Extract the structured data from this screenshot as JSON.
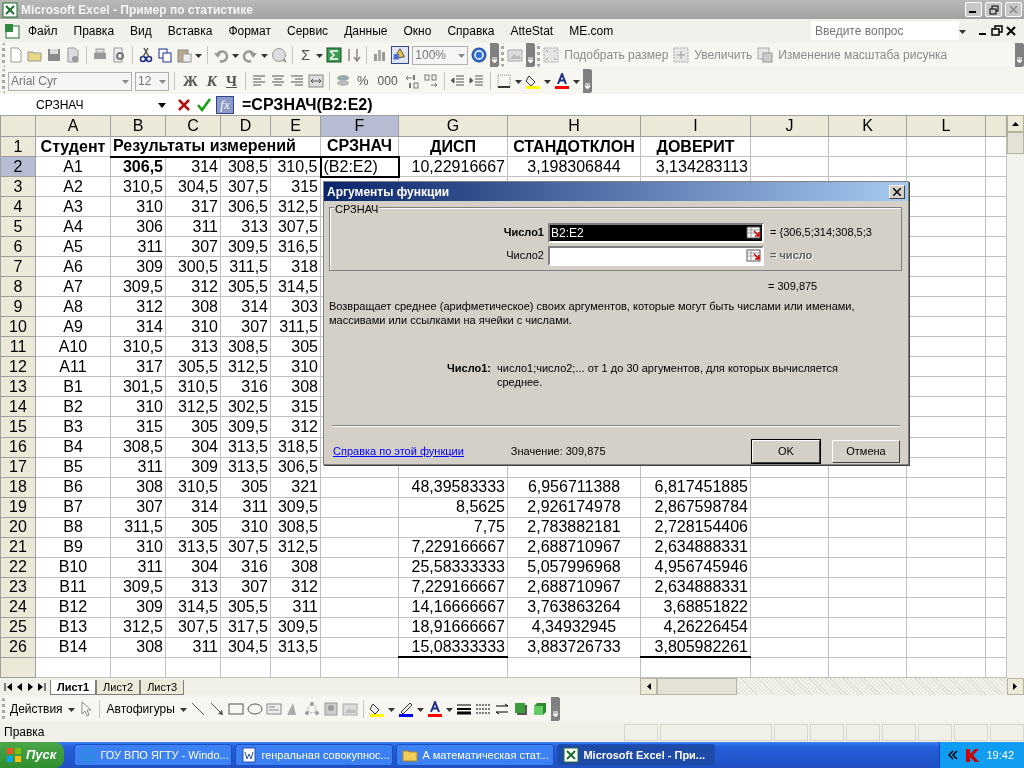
{
  "window": {
    "title": "Microsoft Excel - Пример по статистике"
  },
  "menu": [
    "Файл",
    "Правка",
    "Вид",
    "Вставка",
    "Формат",
    "Сервис",
    "Данные",
    "Окно",
    "Справка",
    "AtteStat",
    "ME.com"
  ],
  "help_search": {
    "placeholder": "Введите вопрос"
  },
  "standard_toolbar": {
    "sum": "Σ",
    "zoom": "100%",
    "drawing_on": true
  },
  "picture_toolbar": [
    {
      "label": "Подобрать размер",
      "disabled": true
    },
    {
      "label": "Увеличить",
      "disabled": true
    },
    {
      "label": "Изменение масштаба рисунка",
      "disabled": true
    }
  ],
  "format_toolbar": {
    "font": "Arial Cyr",
    "size": "12",
    "bold": "Ж",
    "italic": "К",
    "underline": "Ч",
    "percent": "%",
    "thousands": "000"
  },
  "formula_bar": {
    "name_box": "СРЗНАЧ",
    "function_button": "fx",
    "formula": "=СРЗНАЧ(B2:E2)"
  },
  "sheet": {
    "columns": [
      {
        "label": "A",
        "selected": false
      },
      {
        "label": "B",
        "selected": false
      },
      {
        "label": "C",
        "selected": false
      },
      {
        "label": "D",
        "selected": false
      },
      {
        "label": "E",
        "selected": false
      },
      {
        "label": "F",
        "selected": true
      },
      {
        "label": "G",
        "selected": false
      },
      {
        "label": "H",
        "selected": false
      },
      {
        "label": "I",
        "selected": false
      },
      {
        "label": "J",
        "selected": false
      },
      {
        "label": "K",
        "selected": false
      },
      {
        "label": "L",
        "selected": false
      }
    ],
    "rows": [
      {
        "header": "1",
        "selected": false,
        "cells": [
          {
            "text": "Студент",
            "bold": true
          },
          {
            "text": "Результаты измерений",
            "bold": true,
            "bottom_border": true,
            "colspan": 4
          },
          {
            "text": "СРЗНАЧ",
            "bold": true
          },
          {
            "text": "ДИСП",
            "bold": true
          },
          {
            "text": "СТАНДОТКЛОН",
            "bold": true
          },
          {
            "text": "ДОВЕРИТ",
            "bold": true
          },
          null,
          null,
          null
        ]
      },
      {
        "header": "2",
        "selected": true,
        "cells": [
          "A1",
          {
            "text": "306,5",
            "bold": true
          },
          "314",
          "308,5",
          "310,5",
          "(B2:E2)",
          "10,22916667",
          "3,198306844",
          "3,134283113",
          null,
          null,
          null
        ]
      },
      {
        "header": "3",
        "selected": false,
        "cells": [
          "A2",
          "310,5",
          "304,5",
          "307,5",
          "315",
          null,
          null,
          null,
          null,
          null,
          null,
          null
        ]
      },
      {
        "header": "4",
        "selected": false,
        "cells": [
          "A3",
          "310",
          "317",
          "306,5",
          "312,5",
          null,
          null,
          null,
          null,
          null,
          null,
          null
        ]
      },
      {
        "header": "5",
        "selected": false,
        "cells": [
          "A4",
          "306",
          "311",
          "313",
          "307,5",
          null,
          null,
          null,
          null,
          null,
          null,
          null
        ]
      },
      {
        "header": "6",
        "selected": false,
        "cells": [
          "A5",
          "311",
          "307",
          "309,5",
          "316,5",
          null,
          null,
          null,
          null,
          null,
          null,
          null
        ]
      },
      {
        "header": "7",
        "selected": false,
        "cells": [
          "A6",
          "309",
          "300,5",
          "311,5",
          "318",
          null,
          null,
          null,
          null,
          null,
          null,
          null
        ]
      },
      {
        "header": "8",
        "selected": false,
        "cells": [
          "A7",
          "309,5",
          "312",
          "305,5",
          "314,5",
          null,
          null,
          null,
          null,
          null,
          null,
          null
        ]
      },
      {
        "header": "9",
        "selected": false,
        "cells": [
          "A8",
          "312",
          "308",
          "314",
          "303",
          null,
          null,
          null,
          null,
          null,
          null,
          null
        ]
      },
      {
        "header": "10",
        "selected": false,
        "cells": [
          "A9",
          "314",
          "310",
          "307",
          "311,5",
          null,
          null,
          null,
          null,
          null,
          null,
          null
        ]
      },
      {
        "header": "11",
        "selected": false,
        "cells": [
          "A10",
          "310,5",
          "313",
          "308,5",
          "305",
          null,
          null,
          null,
          null,
          null,
          null,
          null
        ]
      },
      {
        "header": "12",
        "selected": false,
        "cells": [
          "A11",
          "317",
          "305,5",
          "312,5",
          "310",
          null,
          null,
          null,
          null,
          null,
          null,
          null
        ]
      },
      {
        "header": "13",
        "selected": false,
        "cells": [
          "B1",
          "301,5",
          "310,5",
          "316",
          "308",
          null,
          null,
          null,
          null,
          null,
          null,
          null
        ]
      },
      {
        "header": "14",
        "selected": false,
        "cells": [
          "B2",
          "310",
          "312,5",
          "302,5",
          "315",
          null,
          null,
          null,
          null,
          null,
          null,
          null
        ]
      },
      {
        "header": "15",
        "selected": false,
        "cells": [
          "B3",
          "315",
          "305",
          "309,5",
          "312",
          null,
          null,
          null,
          null,
          null,
          null,
          null
        ]
      },
      {
        "header": "16",
        "selected": false,
        "cells": [
          "B4",
          "308,5",
          "304",
          "313,5",
          "318,5",
          null,
          null,
          null,
          null,
          null,
          null,
          null
        ]
      },
      {
        "header": "17",
        "selected": false,
        "cells": [
          "B5",
          "311",
          "309",
          "313,5",
          "306,5",
          null,
          null,
          null,
          null,
          null,
          null,
          null
        ]
      },
      {
        "header": "18",
        "selected": false,
        "cells": [
          "B6",
          "308",
          "310,5",
          "305",
          "321",
          null,
          "48,39583333",
          "6,956711388",
          "6,817451885",
          null,
          null,
          null
        ]
      },
      {
        "header": "19",
        "selected": false,
        "cells": [
          "B7",
          "307",
          "314",
          "311",
          "309,5",
          null,
          "8,5625",
          "2,926174978",
          "2,867598784",
          null,
          null,
          null
        ]
      },
      {
        "header": "20",
        "selected": false,
        "cells": [
          "B8",
          "311,5",
          "305",
          "310",
          "308,5",
          null,
          "7,75",
          "2,783882181",
          "2,728154406",
          null,
          null,
          null
        ]
      },
      {
        "header": "21",
        "selected": false,
        "cells": [
          "B9",
          "310",
          "313,5",
          "307,5",
          "312,5",
          null,
          "7,229166667",
          "2,688710967",
          "2,634888331",
          null,
          null,
          null
        ]
      },
      {
        "header": "22",
        "selected": false,
        "cells": [
          "B10",
          "311",
          "304",
          "316",
          "308",
          null,
          "25,58333333",
          "5,057996968",
          "4,956745946",
          null,
          null,
          null
        ]
      },
      {
        "header": "23",
        "selected": false,
        "cells": [
          "B11",
          "309,5",
          "313",
          "307",
          "312",
          null,
          "7,229166667",
          "2,688710967",
          "2,634888331",
          null,
          null,
          null
        ]
      },
      {
        "header": "24",
        "selected": false,
        "cells": [
          "B12",
          "309",
          "314,5",
          "305,5",
          "311",
          null,
          "14,16666667",
          "3,763863264",
          "3,68851822",
          null,
          null,
          null
        ]
      },
      {
        "header": "25",
        "selected": false,
        "cells": [
          "B13",
          "312,5",
          "307,5",
          "317,5",
          "309,5",
          null,
          "18,91666667",
          "4,34932945",
          "4,26226454",
          null,
          null,
          null
        ]
      },
      {
        "header": "26",
        "selected": false,
        "cells": [
          "B14",
          "308",
          "311",
          "304,5",
          "313,5",
          null,
          {
            "text": "15,08333333",
            "bottom_border": true
          },
          "3,883726733",
          {
            "text": "3,805982261",
            "bottom_border": true
          },
          null,
          null,
          null
        ]
      }
    ]
  },
  "dialog": {
    "title": "Аргументы функции",
    "function": "СРЗНАЧ",
    "args": [
      {
        "label": "Число1",
        "value": "B2:E2",
        "result": "= {306,5;314;308,5;3",
        "selected": true
      },
      {
        "label": "Число2",
        "result": "= число",
        "selected": false
      }
    ],
    "result": "= 309,875",
    "description": "Возвращает среднее (арифметическое) своих аргументов, которые могут быть числами или именами, массивами или ссылками на ячейки с числами.",
    "arg_help": {
      "label": "Число1:",
      "text": "число1;число2;... от 1 до 30 аргументов, для которых вычисляется среднее."
    },
    "help_link": "Справка по этой функции",
    "value": "Значение: 309,875",
    "buttons": [
      "OK",
      "Отмена"
    ]
  },
  "sheet_tabs": [
    {
      "label": "Лист1",
      "selected": true
    },
    {
      "label": "Лист2",
      "selected": false
    },
    {
      "label": "Лист3",
      "selected": false
    }
  ],
  "drawing_toolbar": {
    "actions": "Действия",
    "autoshapes": "Автофигуры"
  },
  "status_bar": {
    "text": "Правка"
  },
  "taskbar": {
    "start": "Пуск",
    "tasks": [
      {
        "label": "ГОУ ВПО ЯГТУ - Windo...",
        "kind": "browser",
        "selected": false
      },
      {
        "label": "генральная совокупнос...",
        "kind": "word",
        "selected": false
      },
      {
        "label": "А математическая стат...",
        "kind": "folder",
        "selected": false
      },
      {
        "label": "Microsoft Excel - При...",
        "kind": "excel",
        "selected": true
      }
    ],
    "clock": "19:42"
  }
}
